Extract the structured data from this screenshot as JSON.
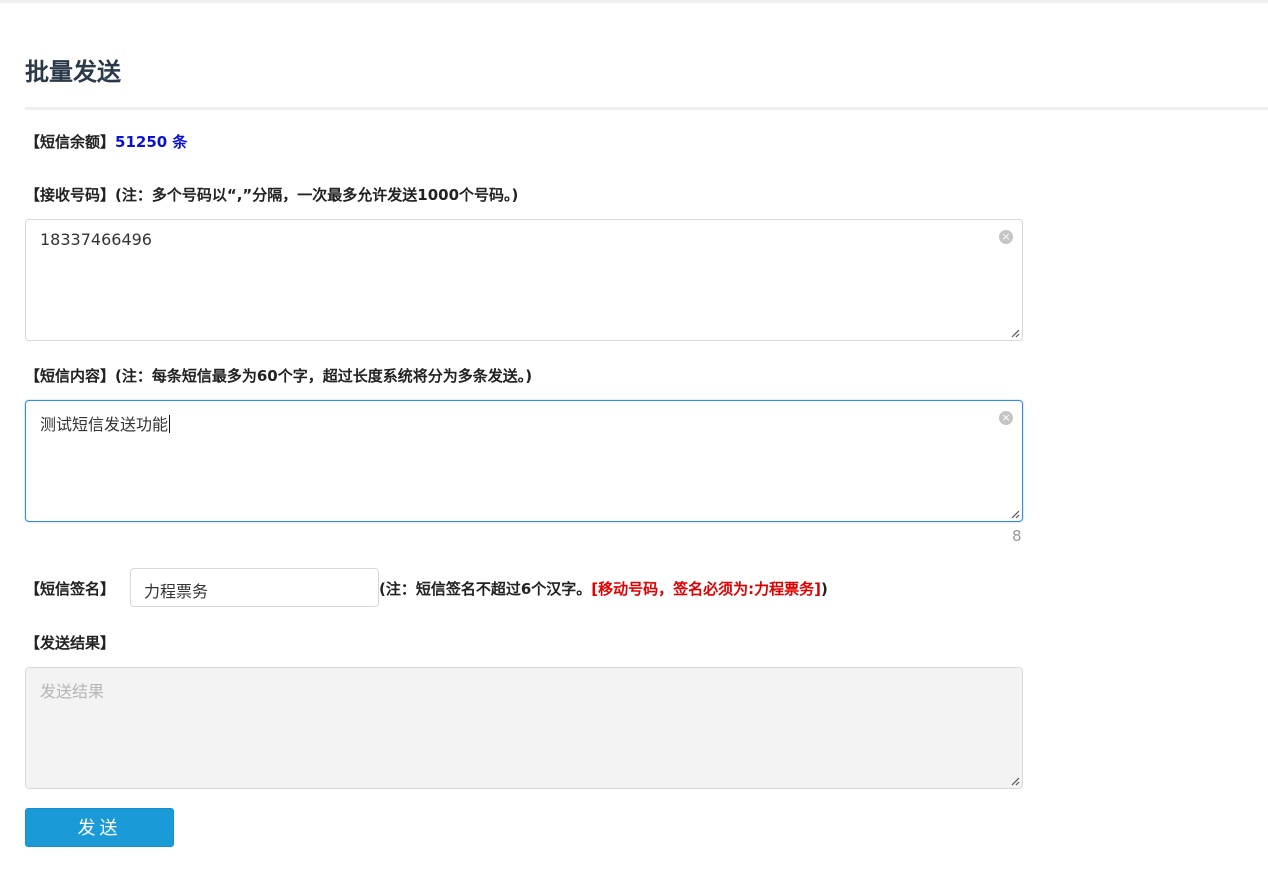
{
  "page": {
    "title": "批量发送"
  },
  "balance": {
    "label": "【短信余额】",
    "value": "51250 条"
  },
  "recipients": {
    "label": "【接收号码】(注：多个号码以“,”分隔，一次最多允许发送1000个号码。)",
    "value": "18337466496",
    "clear_glyph": "×"
  },
  "content": {
    "label": "【短信内容】(注：每条短信最多为60个字，超过长度系统将分为多条发送。)",
    "value": "测试短信发送功能",
    "char_count": "8",
    "clear_glyph": "×"
  },
  "signature": {
    "label": "【短信签名】",
    "value": "力程票务",
    "note": "(注：短信签名不超过6个汉字。",
    "note_red": "[移动号码，签名必须为:力程票务]",
    "note_end": ")"
  },
  "result": {
    "label": "【发送结果】",
    "placeholder": "发送结果"
  },
  "send_button": {
    "label": "发送"
  },
  "colors": {
    "balance": "#0b12d6",
    "warning": "#e00000",
    "button": "#1a9bd8",
    "focus_border": "#2d8cf0"
  }
}
